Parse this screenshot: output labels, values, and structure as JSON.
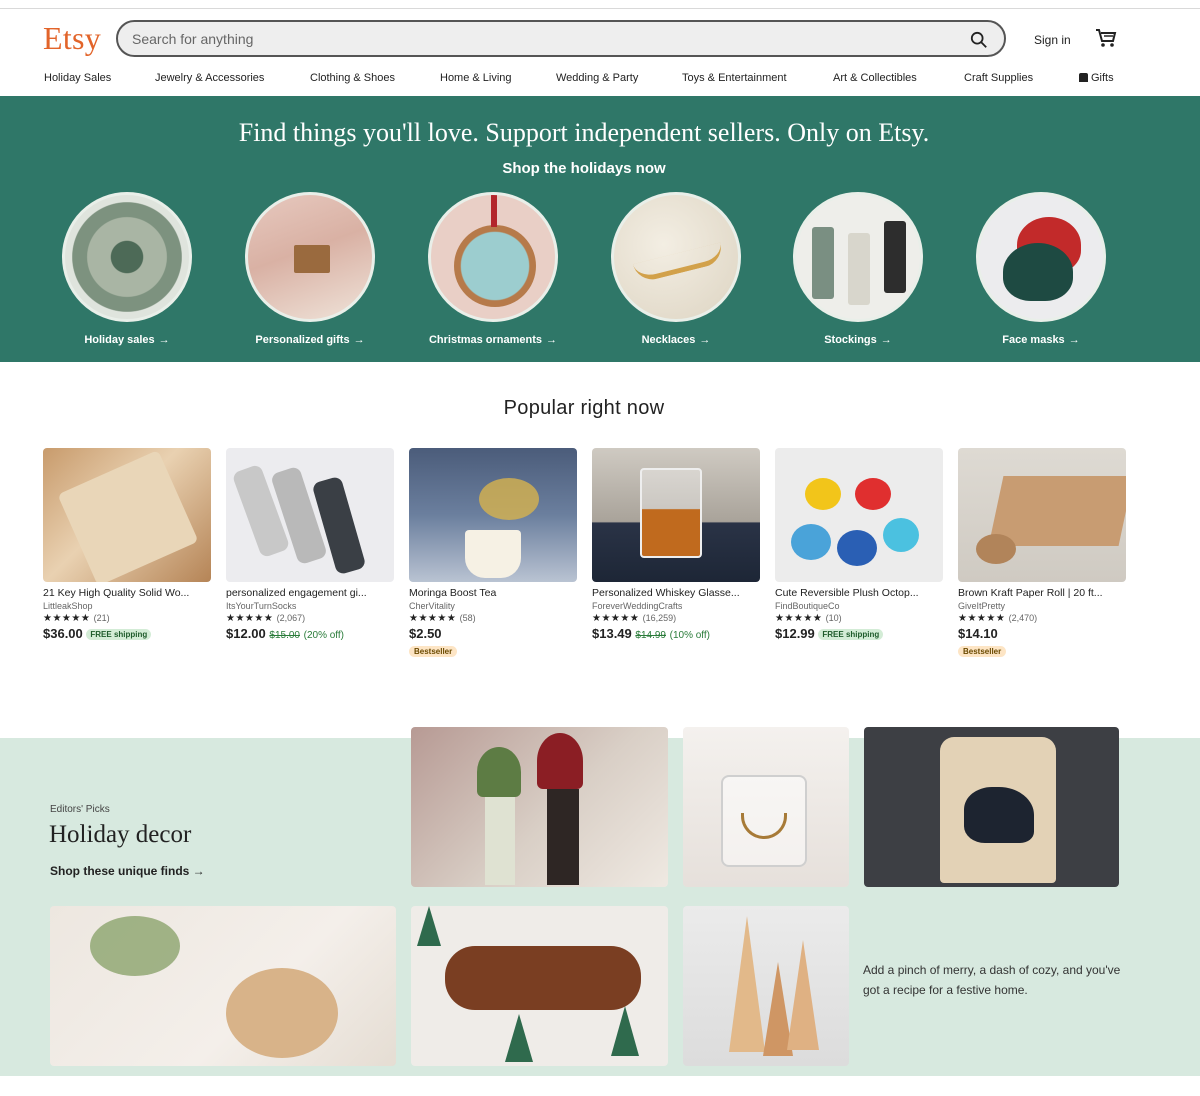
{
  "header": {
    "logo": "Etsy",
    "search_placeholder": "Search for anything",
    "sign_in": "Sign in",
    "search_icon": "search-icon",
    "cart_icon": "cart-icon"
  },
  "nav": [
    "Holiday Sales",
    "Jewelry & Accessories",
    "Clothing & Shoes",
    "Home & Living",
    "Wedding & Party",
    "Toys & Entertainment",
    "Art & Collectibles",
    "Craft Supplies",
    "Gifts"
  ],
  "hero": {
    "title": "Find things you'll love. Support independent sellers. Only on Etsy.",
    "subtitle": "Shop the holidays now",
    "categories": [
      {
        "label": "Holiday sales"
      },
      {
        "label": "Personalized gifts"
      },
      {
        "label": "Christmas ornaments"
      },
      {
        "label": "Necklaces"
      },
      {
        "label": "Stockings"
      },
      {
        "label": "Face masks"
      }
    ],
    "arrow": "→"
  },
  "popular": {
    "title": "Popular right now",
    "items": [
      {
        "title": "21 Key High Quality Solid Wo...",
        "shop": "LittleakShop",
        "stars": "★★★★★",
        "reviews": "(21)",
        "price": "$36.00",
        "original": "",
        "discount": "",
        "badge": "FREE shipping",
        "badge_type": "free"
      },
      {
        "title": "personalized engagement gi...",
        "shop": "ItsYourTurnSocks",
        "stars": "★★★★★",
        "reviews": "(2,067)",
        "price": "$12.00",
        "original": "$15.00",
        "discount": "(20% off)",
        "badge": "",
        "badge_type": ""
      },
      {
        "title": "Moringa Boost Tea",
        "shop": "CherVitality",
        "stars": "★★★★★",
        "reviews": "(58)",
        "price": "$2.50",
        "original": "",
        "discount": "",
        "badge": "Bestseller",
        "badge_type": "best"
      },
      {
        "title": "Personalized Whiskey Glasse...",
        "shop": "ForeverWeddingCrafts",
        "stars": "★★★★★",
        "reviews": "(16,259)",
        "price": "$13.49",
        "original": "$14.99",
        "discount": "(10% off)",
        "badge": "",
        "badge_type": ""
      },
      {
        "title": "Cute Reversible Plush Octop...",
        "shop": "FindBoutiqueCo",
        "stars": "★★★★★",
        "reviews": "(10)",
        "price": "$12.99",
        "original": "",
        "discount": "",
        "badge": "FREE shipping",
        "badge_type": "free"
      },
      {
        "title": "Brown Kraft Paper Roll | 20 ft...",
        "shop": "GiveItPretty",
        "stars": "★★★★★",
        "reviews": "(2,470)",
        "price": "$14.10",
        "original": "",
        "discount": "",
        "badge": "Bestseller",
        "badge_type": "best"
      }
    ]
  },
  "editors": {
    "eyebrow": "Editors' Picks",
    "title": "Holiday decor",
    "link": "Shop these unique finds →",
    "description": "Add a pinch of merry, a dash of cozy, and you've got a recipe for a festive home."
  },
  "colors": {
    "brand": "#e2642a",
    "hero_bg": "#2f7768",
    "picks_bg": "#d7e9df",
    "discount_green": "#2a7c3a"
  }
}
